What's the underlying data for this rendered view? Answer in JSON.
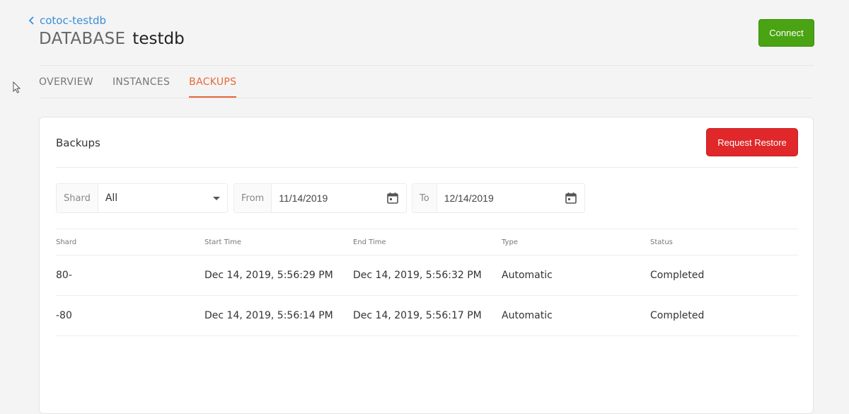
{
  "breadcrumb": {
    "label": "cotoc-testdb"
  },
  "header": {
    "prefix": "DATABASE",
    "name": "testdb",
    "connect_label": "Connect"
  },
  "tabs": [
    {
      "label": "OVERVIEW",
      "active": false
    },
    {
      "label": "INSTANCES",
      "active": false
    },
    {
      "label": "BACKUPS",
      "active": true
    }
  ],
  "backups": {
    "title": "Backups",
    "restore_label": "Request Restore",
    "filters": {
      "shard": {
        "label": "Shard",
        "value": "All"
      },
      "from": {
        "label": "From",
        "value": "11/14/2019"
      },
      "to": {
        "label": "To",
        "value": "12/14/2019"
      }
    },
    "columns": [
      "Shard",
      "Start Time",
      "End Time",
      "Type",
      "Status"
    ],
    "rows": [
      [
        "80-",
        "Dec 14, 2019, 5:56:29 PM",
        "Dec 14, 2019, 5:56:32 PM",
        "Automatic",
        "Completed"
      ],
      [
        "-80",
        "Dec 14, 2019, 5:56:14 PM",
        "Dec 14, 2019, 5:56:17 PM",
        "Automatic",
        "Completed"
      ]
    ]
  },
  "colors": {
    "link": "#3b8fd9",
    "accent": "#e8673a",
    "connect": "#4aa312",
    "danger": "#e0272a"
  }
}
